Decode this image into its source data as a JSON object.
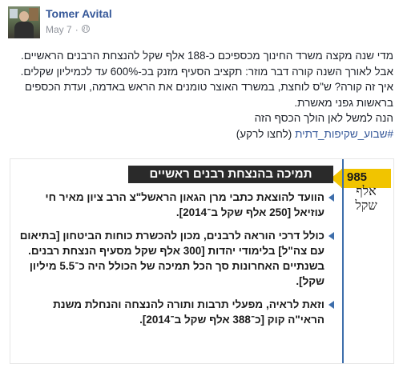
{
  "post": {
    "author": "Tomer Avital",
    "date": "May 7",
    "separator": "·",
    "paragraph1": "מדי שנה מקצה משרד החינוך מכספיכם כ-188 אלף שקל להנצחת הרבנים הראשיים.",
    "paragraph2": "אבל לאורך השנה קורה דבר מוזר: תקציב הסעיף מזנק בכ-600% עד לכמיליון שקלים.",
    "paragraph3": "איך זה קורה? ש\"ס לוחצת, במשרד האוצר טומנים את הראש באדמה, ועדת הכספים בראשות גפני מאשרת.",
    "paragraph4": "הנה למשל לאן הולך הכסף הזה",
    "hashtag": "#שבוע_שקיפות_דתית",
    "click_hint": "(לחצו לרקע)"
  },
  "card": {
    "badge_number": "985",
    "badge_label": "אלף שקל",
    "title": "תמיכה בהנצחת רבנים ראשיים",
    "bullets": [
      "הוועד להוצאת כתבי מרן הגאון הראשל\"צ הרב ציון מאיר חי עוזיאל [250 אלף שקל ב־2014].",
      "כולל דרכי הוראה לרבנים, מכון להכשרת כוחות הביטחון [בתיאום עם צה\"ל] בלימודי יהדות [300 אלף שקל מסעיף הנצחת רבנים. בשנתיים האחרונות סך הכל תמיכה של הכולל היה כ־5.5 מיליון שקל].",
      "וזאת לראיה, מפעלי תרבות ותורה להנצחה והנחלת משנת הראי\"ה קוק [כ־388 אלף שקל ב־2014]."
    ]
  },
  "colors": {
    "author_link": "#365899",
    "badge_yellow": "#f1c400",
    "timeline_blue": "#3e6eab"
  }
}
